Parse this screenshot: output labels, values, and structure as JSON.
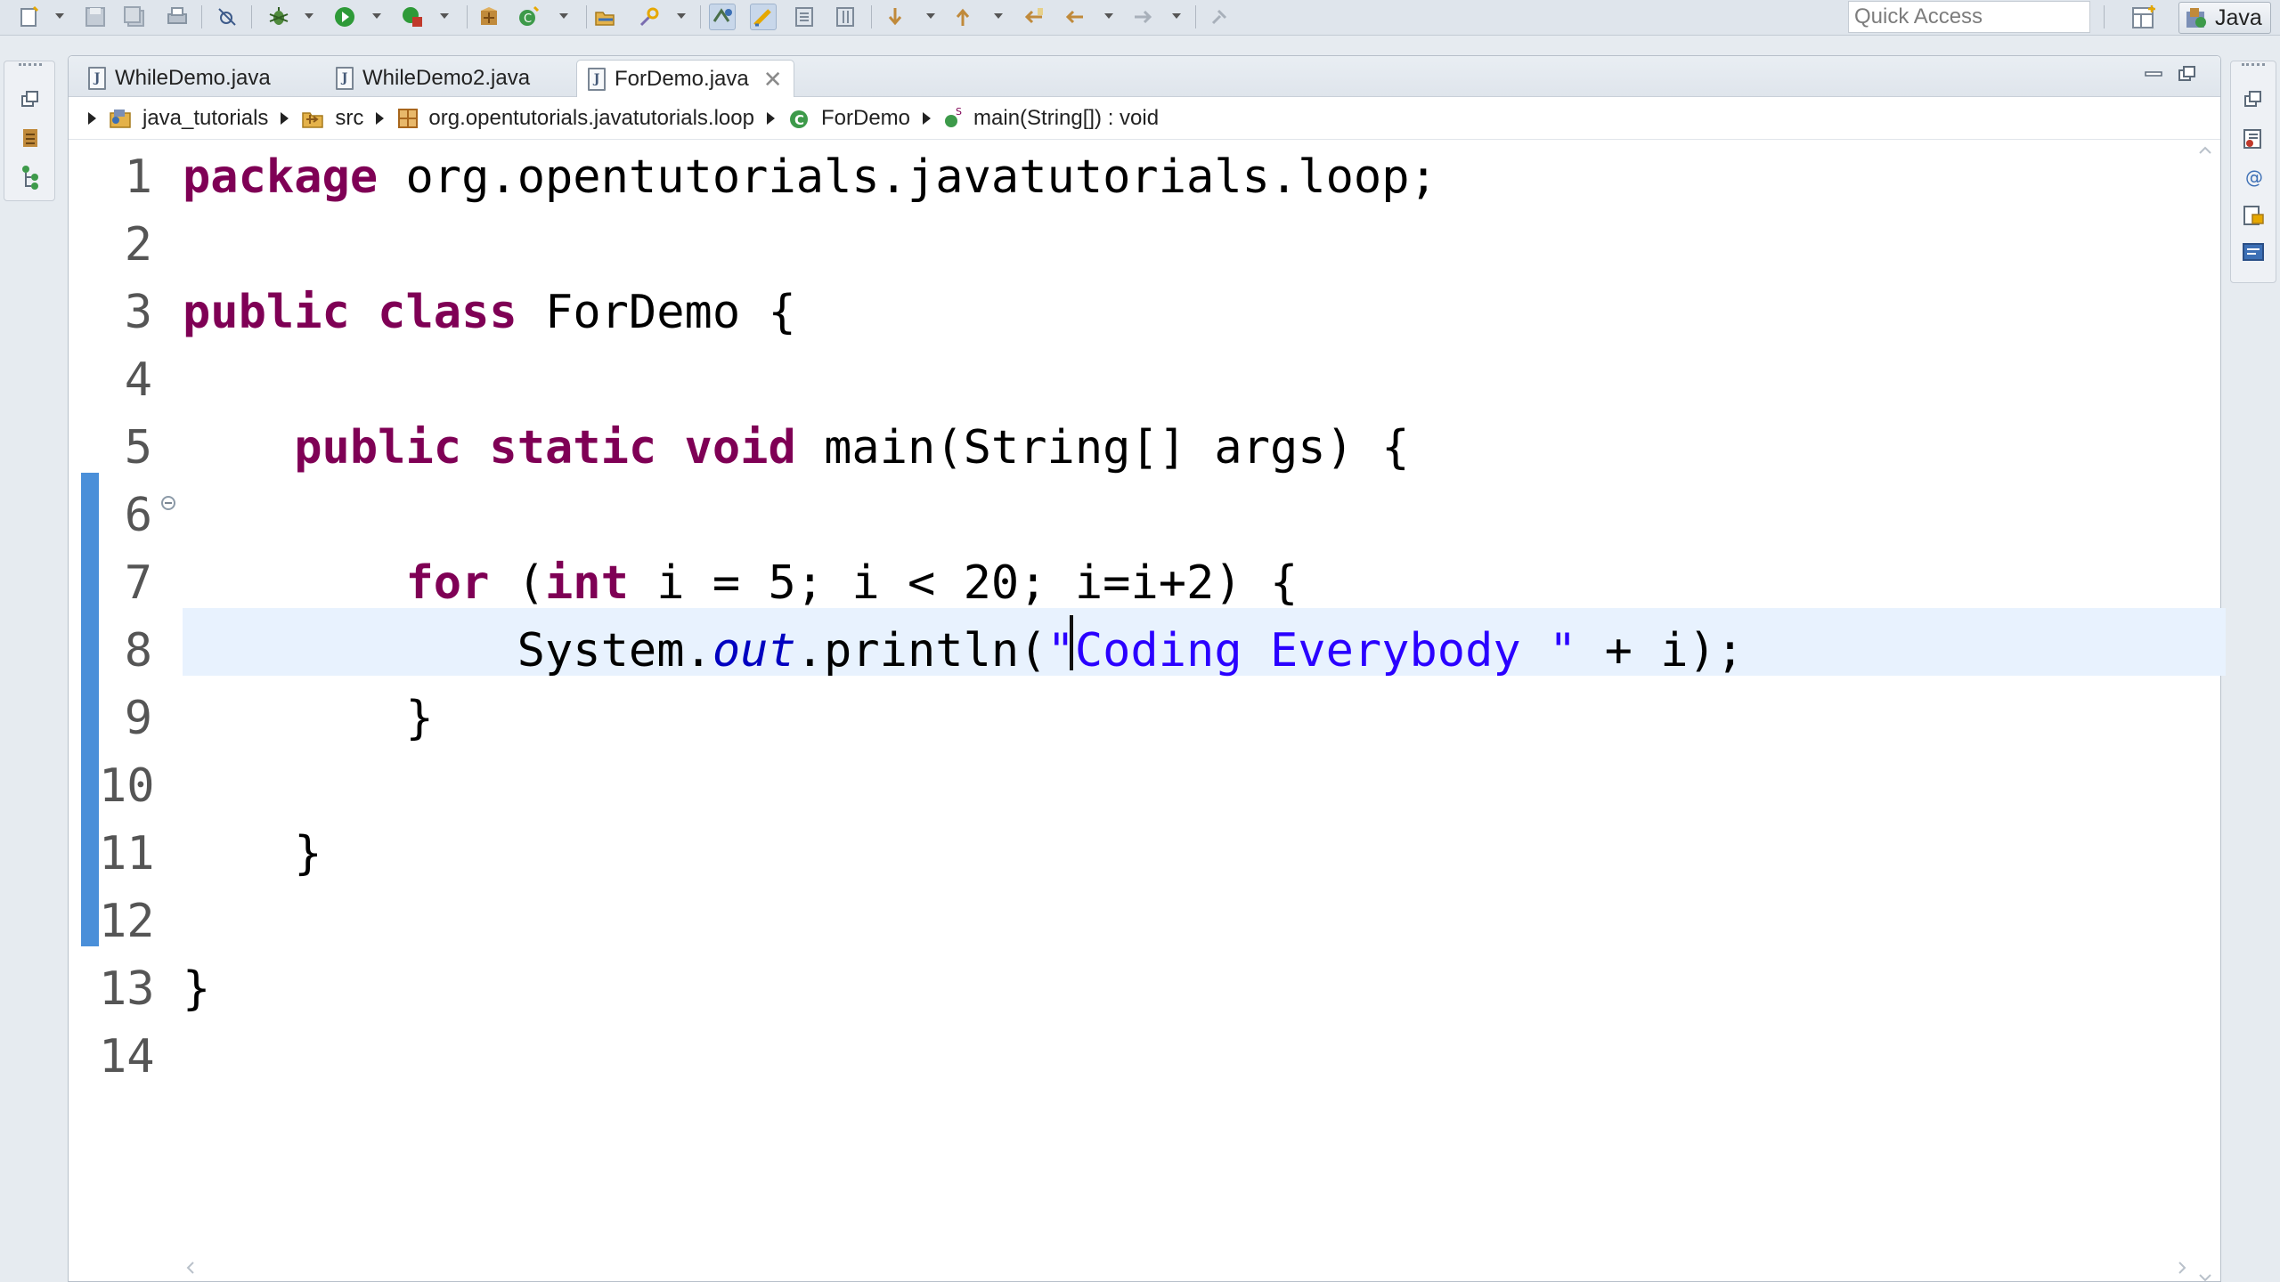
{
  "toolbar": {
    "icons": [
      "new-icon",
      "save-icon",
      "save-all-icon",
      "print-icon",
      "skip-breakpoints-icon",
      "debug-icon",
      "run-icon",
      "coverage-icon",
      "new-java-project-icon",
      "new-java-class-icon",
      "open-type-icon",
      "search-icon",
      "toggle-mark-occurrences-icon",
      "toggle-highlight-icon",
      "show-whitespace-icon",
      "toggle-block-selection-icon",
      "next-annotation-icon",
      "previous-annotation-icon",
      "last-edit-location-icon",
      "back-icon",
      "forward-icon",
      "pin-editor-icon"
    ],
    "quick_access_placeholder": "Quick Access",
    "perspective_label": "Java"
  },
  "tabs": [
    {
      "label": "WhileDemo.java",
      "active": false
    },
    {
      "label": "WhileDemo2.java",
      "active": false
    },
    {
      "label": "ForDemo.java",
      "active": true
    }
  ],
  "breadcrumb": [
    {
      "label": "java_tutorials",
      "icon": "project-icon"
    },
    {
      "label": "src",
      "icon": "source-folder-icon"
    },
    {
      "label": "org.opentutorials.javatutorials.loop",
      "icon": "package-icon"
    },
    {
      "label": "ForDemo",
      "icon": "class-icon"
    },
    {
      "label": "main(String[]) : void",
      "icon": "method-icon"
    }
  ],
  "editor": {
    "line_numbers": [
      "1",
      "2",
      "3",
      "4",
      "5",
      "6",
      "7",
      "8",
      "9",
      "10",
      "11",
      "12",
      "13",
      "14"
    ],
    "current_line": 7,
    "lines": [
      "package org.opentutorials.javatutorials.loop;",
      "",
      "public class ForDemo {",
      "",
      "    public static void main(String[] args) {",
      "",
      "        for (int i = 5; i < 20; i=i+2) {",
      "            System.out.println(\"Coding Everybody \" + i);",
      "        }",
      "",
      "    }",
      "",
      "}",
      ""
    ]
  },
  "colors": {
    "keyword": "#7f0055",
    "string": "#2a00ff",
    "field": "#0000c0",
    "current_line_bg": "#e8f2fe",
    "change_bar": "#4a8fd9"
  }
}
